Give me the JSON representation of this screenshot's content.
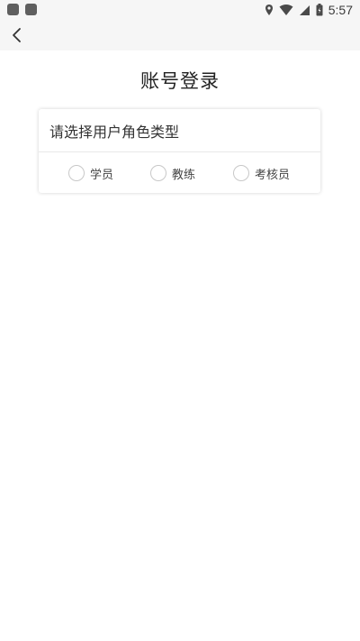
{
  "status_bar": {
    "time": "5:57",
    "icons": [
      "app-notification-icon",
      "app-notification-icon",
      "location-icon",
      "wifi-icon",
      "signal-icon",
      "battery-icon"
    ]
  },
  "app_bar": {
    "back_icon": "back-arrow-icon"
  },
  "page": {
    "title": "账号登录"
  },
  "role_card": {
    "header": "请选择用户角色类型",
    "options": [
      {
        "label": "学员",
        "selected": false
      },
      {
        "label": "教练",
        "selected": false
      },
      {
        "label": "考核员",
        "selected": false
      }
    ]
  }
}
